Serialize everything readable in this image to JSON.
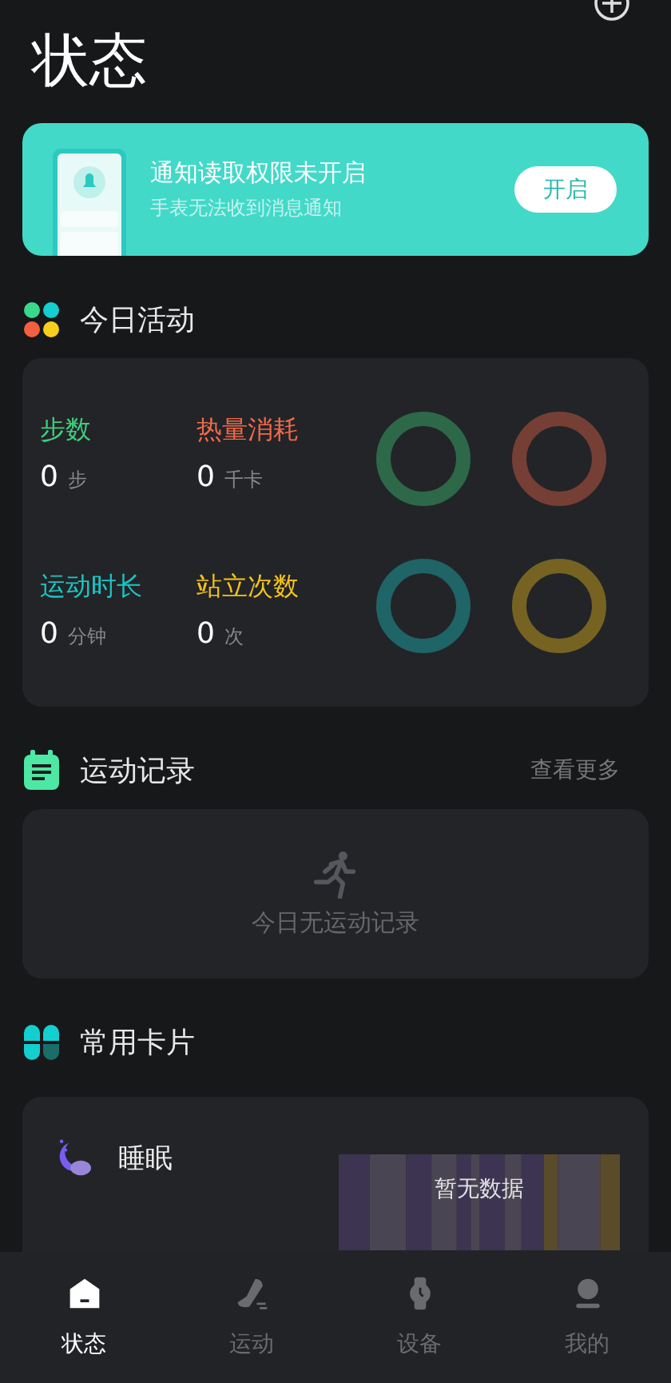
{
  "title": "状态",
  "banner": {
    "title": "通知读取权限未开启",
    "subtitle": "手表无法收到消息通知",
    "button": "开启"
  },
  "activity": {
    "heading": "今日活动",
    "metrics": [
      {
        "label": "步数",
        "value": "0",
        "unit": "步",
        "color": "#3ccf7e"
      },
      {
        "label": "热量消耗",
        "value": "0",
        "unit": "千卡",
        "color": "#f06a4a"
      },
      {
        "label": "运动时长",
        "value": "0",
        "unit": "分钟",
        "color": "#19c6c6"
      },
      {
        "label": "站立次数",
        "value": "0",
        "unit": "次",
        "color": "#f2c31c"
      }
    ]
  },
  "records": {
    "heading": "运动记录",
    "more": "查看更多",
    "empty": "今日无运动记录"
  },
  "cards": {
    "heading": "常用卡片",
    "sleep": {
      "title": "睡眠",
      "chart_note": "暂无数据"
    }
  },
  "tabs": [
    {
      "label": "状态",
      "kind": "home",
      "selected": true
    },
    {
      "label": "运动",
      "kind": "shoe",
      "selected": false
    },
    {
      "label": "设备",
      "kind": "watch",
      "selected": false
    },
    {
      "label": "我的",
      "kind": "person",
      "selected": false
    }
  ]
}
